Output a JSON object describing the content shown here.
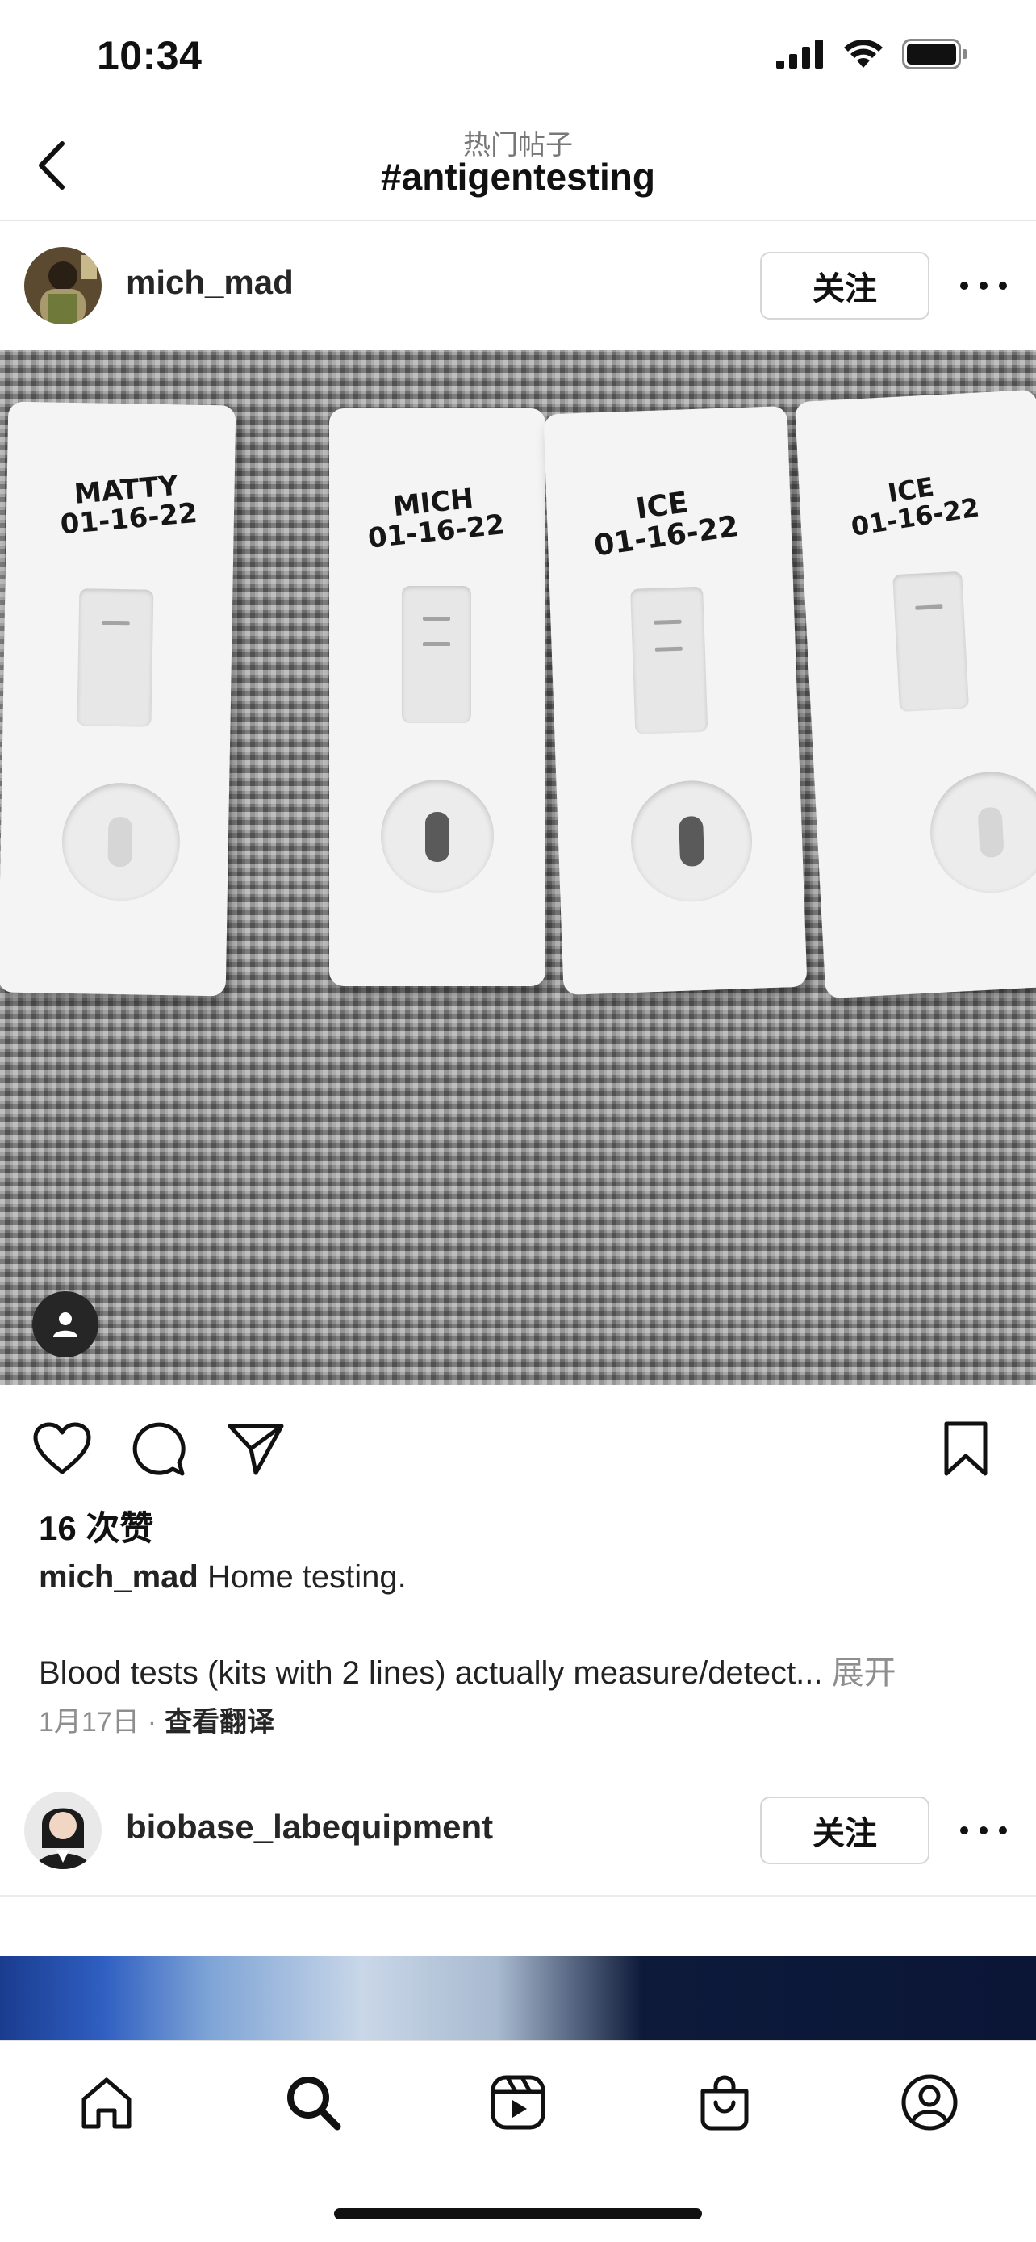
{
  "status_bar": {
    "time": "10:34",
    "icons": [
      "cellular-signal-icon",
      "wifi-icon",
      "battery-icon"
    ]
  },
  "header": {
    "subtitle": "热门帖子",
    "title": "#antigentesting",
    "back_icon": "chevron-left-icon"
  },
  "post": {
    "username": "mich_mad",
    "follow_label": "关注",
    "photo": {
      "kit_labels": [
        {
          "name": "MATTY",
          "date": "01-16-22"
        },
        {
          "name": "MICH",
          "date": "01-16-22"
        },
        {
          "name": "ICE",
          "date": "01-16-22"
        },
        {
          "name": "ICE",
          "date": "01-16-22"
        }
      ]
    },
    "likes": "16 次赞",
    "caption_user": "mich_mad",
    "caption_text": "Home testing.",
    "caption_more": "Blood tests (kits with 2 lines) actually measure/detect...",
    "expand_label": "展开",
    "date": "1月17日",
    "separator": "·",
    "translate_label": "查看翻译"
  },
  "next_post": {
    "username": "biobase_labequipment",
    "follow_label": "关注"
  },
  "tab_bar": {
    "items": [
      "home-icon",
      "search-icon",
      "reels-icon",
      "shop-icon",
      "profile-icon"
    ],
    "active": "search-icon"
  },
  "colors": {
    "text": "#111111",
    "secondary_text": "#8e8e8e",
    "border": "#d6d6d6",
    "background": "#ffffff"
  }
}
